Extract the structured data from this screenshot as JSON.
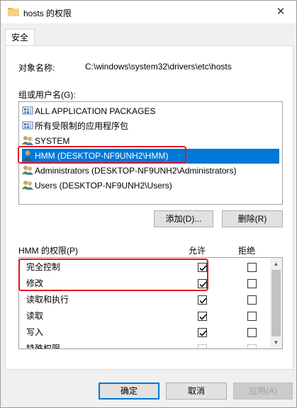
{
  "window": {
    "title": "hosts 的权限",
    "close_glyph": "✕"
  },
  "tab": {
    "label": "安全"
  },
  "object": {
    "label": "对象名称:",
    "value": "C:\\windows\\system32\\drivers\\etc\\hosts"
  },
  "groups": {
    "label": "组或用户名(G):",
    "items": [
      {
        "label": "ALL APPLICATION PACKAGES",
        "icon": "group-packages-icon"
      },
      {
        "label": "所有受限制的应用程序包",
        "icon": "group-packages-icon"
      },
      {
        "label": "SYSTEM",
        "icon": "users-group-icon"
      },
      {
        "label": "HMM (DESKTOP-NF9UNH2\\HMM)",
        "icon": "user-icon",
        "selected": true
      },
      {
        "label": "Administrators (DESKTOP-NF9UNH2\\Administrators)",
        "icon": "users-group-icon"
      },
      {
        "label": "Users (DESKTOP-NF9UNH2\\Users)",
        "icon": "users-group-icon"
      }
    ],
    "add_label": "添加(D)...",
    "remove_label": "删除(R)"
  },
  "permissions": {
    "label": "HMM 的权限(P)",
    "allow_header": "允许",
    "deny_header": "拒绝",
    "rows": [
      {
        "name": "完全控制",
        "allow": true,
        "deny": false
      },
      {
        "name": "修改",
        "allow": true,
        "deny": false
      },
      {
        "name": "读取和执行",
        "allow": true,
        "deny": false
      },
      {
        "name": "读取",
        "allow": true,
        "deny": false
      },
      {
        "name": "写入",
        "allow": true,
        "deny": false
      },
      {
        "name": "特殊权限",
        "allow": false,
        "deny": false
      }
    ]
  },
  "footer": {
    "ok_label": "确定",
    "cancel_label": "取消",
    "apply_label": "应用(A)"
  },
  "colors": {
    "selection": "#0078d7",
    "highlight_box": "#e81123"
  }
}
